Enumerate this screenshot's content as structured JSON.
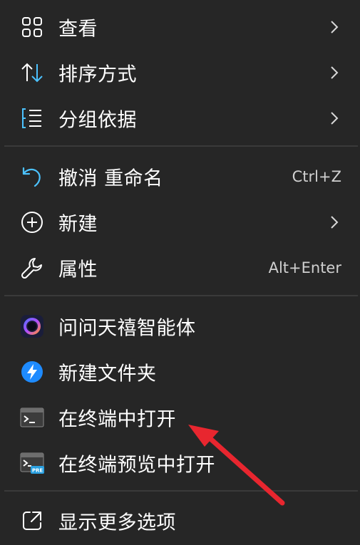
{
  "menu": {
    "items": [
      {
        "label": "查看",
        "icon": "grid-icon",
        "submenu": true
      },
      {
        "label": "排序方式",
        "icon": "sort-arrows-icon",
        "submenu": true
      },
      {
        "label": "分组依据",
        "icon": "group-list-icon",
        "submenu": true
      },
      {
        "label": "撤消 重命名",
        "icon": "undo-icon",
        "shortcut": "Ctrl+Z"
      },
      {
        "label": "新建",
        "icon": "plus-circle-icon",
        "submenu": true
      },
      {
        "label": "属性",
        "icon": "wrench-icon",
        "shortcut": "Alt+Enter"
      },
      {
        "label": "问问天禧智能体",
        "icon": "ai-assistant-ring-icon"
      },
      {
        "label": "新建文件夹",
        "icon": "lightning-app-icon"
      },
      {
        "label": "在终端中打开",
        "icon": "terminal-icon"
      },
      {
        "label": "在终端预览中打开",
        "icon": "terminal-preview-icon",
        "badge": "PRE"
      },
      {
        "label": "显示更多选项",
        "icon": "open-external-icon"
      }
    ]
  },
  "colors": {
    "background": "#262626",
    "text": "#ffffff",
    "shortcut_text": "#d0d0d0",
    "separator": "#3a3a3a",
    "accent_icon": "#4cc2ff",
    "annotation_arrow": "#e8262f"
  }
}
